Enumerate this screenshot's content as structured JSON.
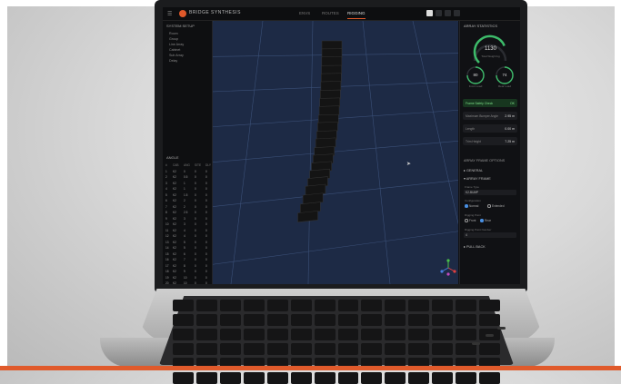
{
  "colors": {
    "accent": "#e0592a",
    "viewport_bg": "#1d2a45",
    "highlight_green": "#7fe08a",
    "gauge_green": "#3dbb6a",
    "bottom_bar": "#e05a2b"
  },
  "app": {
    "brand": "BRIDGE SYNTHESIS",
    "tabs": [
      {
        "label": "ENVS",
        "active": false
      },
      {
        "label": "ROUTES",
        "active": false
      },
      {
        "label": "RIGGING",
        "active": true
      }
    ]
  },
  "left_panel": {
    "title": "SYSTEM SETUP",
    "tree": [
      "Room",
      "Group",
      "Line Array",
      "Cabinet",
      "Sub Array",
      "Delay"
    ],
    "table_title": "ANGLE",
    "table_headers": [
      "#",
      "CAB",
      "ANG",
      "SITE",
      "DLY"
    ],
    "table_rows": [
      [
        "1",
        "K2",
        "0",
        "0",
        "0"
      ],
      [
        "2",
        "K2",
        "0.5",
        "0",
        "0"
      ],
      [
        "3",
        "K2",
        "1",
        "0",
        "0"
      ],
      [
        "4",
        "K2",
        "1",
        "0",
        "0"
      ],
      [
        "5",
        "K2",
        "1.5",
        "0",
        "0"
      ],
      [
        "6",
        "K2",
        "2",
        "0",
        "0"
      ],
      [
        "7",
        "K2",
        "2",
        "0",
        "0"
      ],
      [
        "8",
        "K2",
        "2.5",
        "0",
        "0"
      ],
      [
        "9",
        "K2",
        "3",
        "0",
        "0"
      ],
      [
        "10",
        "K2",
        "3",
        "0",
        "0"
      ],
      [
        "11",
        "K2",
        "4",
        "0",
        "0"
      ],
      [
        "12",
        "K2",
        "4",
        "0",
        "0"
      ],
      [
        "13",
        "K2",
        "5",
        "0",
        "0"
      ],
      [
        "14",
        "K2",
        "5",
        "0",
        "0"
      ],
      [
        "15",
        "K2",
        "6",
        "0",
        "0"
      ],
      [
        "16",
        "K2",
        "7",
        "0",
        "0"
      ],
      [
        "17",
        "K2",
        "8",
        "0",
        "0"
      ],
      [
        "18",
        "K2",
        "9",
        "0",
        "0"
      ],
      [
        "19",
        "K2",
        "10",
        "0",
        "0"
      ],
      [
        "20",
        "K2",
        "10",
        "0",
        "0"
      ],
      [
        "21",
        "K2",
        "10",
        "0",
        "0"
      ],
      [
        "22",
        "K2",
        "10",
        "0",
        "0"
      ]
    ]
  },
  "right_panel": {
    "title": "ARRAY STATISTICS",
    "gauge_value": "1130",
    "gauge_fraction": 0.75,
    "gauge_sub": "Total Weight kg",
    "stat_left": {
      "value": "80",
      "label": "Front Load"
    },
    "stat_right": {
      "value": "74",
      "label": "Rear Load"
    },
    "metrics": [
      {
        "label": "Frame Safety Check",
        "value": "OK",
        "highlight": true
      },
      {
        "label": "Maximum Bumper Angle",
        "value": "2.95 m",
        "highlight": false
      },
      {
        "label": "Length",
        "value": "0.00 m",
        "highlight": false
      },
      {
        "label": "Trim Height",
        "value": "7.25 m",
        "highlight": false
      }
    ],
    "frame_section": "ARRAY FRAME OPTIONS",
    "general": "GENERAL",
    "array_frame": "ARRAY FRAME",
    "frame_type_label": "Frame Type",
    "frame_type_value": "K2-BUMP",
    "config_label": "Configuration",
    "config_options": [
      {
        "label": "Normal",
        "on": true
      },
      {
        "label": "Extended",
        "on": false
      }
    ],
    "rig_label": "Rigging Point",
    "rig_options": [
      {
        "label": "Front",
        "on": false
      },
      {
        "label": "Rear",
        "on": true
      }
    ],
    "points_label": "Rigging Point Number",
    "points_value": "4",
    "pull_back": "PULL BACK"
  },
  "laptop_keys": 84
}
